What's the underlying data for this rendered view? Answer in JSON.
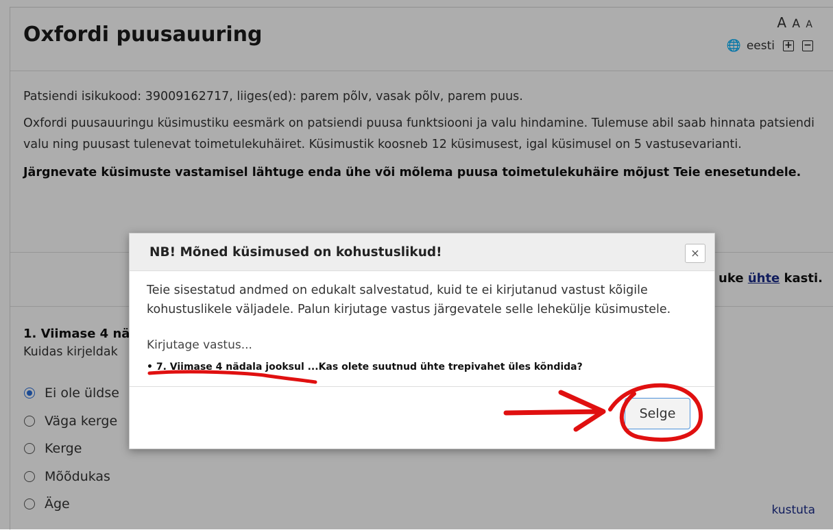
{
  "header": {
    "title": "Oxfordi puusauuring",
    "font_sizes": [
      "A",
      "A",
      "A"
    ],
    "language": "eesti",
    "plus_label": "+",
    "minus_label": "−"
  },
  "intro": {
    "patient_line": "Patsiendi isikukood: 39009162717, liiges(ed): parem põlv, vasak põlv, parem puus.",
    "description": "Oxfordi puusauuringu küsimustiku eesmärk on patsiendi puusa funktsiooni ja valu hindamine. Tulemuse abil saab hinnata patsiendi valu ning puusast tulenevat toimetulekuhäiret. Küsimustik koosneb 12 küsimusest, igal küsimusel on 5 vastusevarianti.",
    "instruction": "Järgnevate küsimuste vastamisel lähtuge enda ühe või mõlema puusa toimetulekuhäire mõjust Teie enesetundele."
  },
  "instruction_right": {
    "prefix": "uke ",
    "underlined": "ühte",
    "suffix": " kasti."
  },
  "question": {
    "title": "1. Viimase 4 nä",
    "subtitle": "Kuidas kirjeldak",
    "options": [
      "Ei ole üldse",
      "Väga kerge",
      "Kerge",
      "Mõõdukas",
      "Äge"
    ],
    "selected_index": 0,
    "clear_label": "kustuta"
  },
  "modal": {
    "title": "NB! Mõned küsimused on kohustuslikud!",
    "close_label": "×",
    "message": "Teie sisestatud andmed on edukalt salvestatud, kuid te ei kirjutanud vastust kõigile kohustuslikele väljadele. Palun kirjutage vastus järgevatele selle lehekülje küsimustele.",
    "hint": "Kirjutage vastus...",
    "missing_item": "• 7. Viimase 4 nädala jooksul ...Kas olete suutnud ühte trepivahet üles kõndida?",
    "ok_label": "Selge"
  },
  "colors": {
    "annotation": "#e01010",
    "link": "#1a2b8a",
    "radio_selected": "#2a6fdb"
  }
}
